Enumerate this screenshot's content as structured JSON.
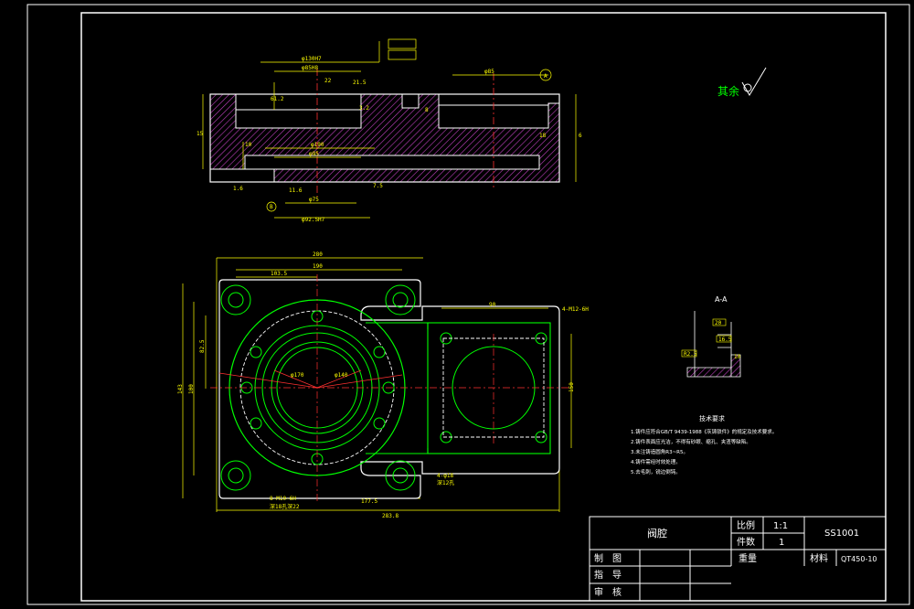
{
  "title_block": {
    "part_name": "阀腔",
    "scale_label": "比例",
    "scale_value": "1:1",
    "qty_label": "件数",
    "qty_value": "1",
    "drawing_no": "SS1001",
    "weight_label": "重量",
    "material_label": "材料",
    "material_value": "QT450-10",
    "drawn_label": "制　图",
    "guide_label": "指　导",
    "review_label": "审　核"
  },
  "roughness_note": "其余",
  "section_label": "A-A",
  "tech_requirements": {
    "title": "技术要求",
    "items": [
      "1.铸件应符合GB/T 9439-1988《灰铸铁件》的规定及技术要求。",
      "2.铸件表面应光洁，不得有砂眼、缩孔、夹渣等缺陷。",
      "3.未注铸造圆角R3~R5。",
      "4.铸件需经时效处理。",
      "5.去毛刺，锐边倒钝。"
    ]
  },
  "dims": {
    "top_total": "280",
    "top_inner": "190",
    "top_left": "103.5",
    "right_w": "90",
    "hole_note_r": "4-M12-6H",
    "left_h1": "143",
    "left_h2": "100",
    "left_h3": "82.5",
    "right_h": "150",
    "bottom_1": "177.5",
    "bottom_2": "283.8",
    "note_bl1": "8-M10-6H",
    "note_bl2": "深18孔深22",
    "note_br1": "4-φ18",
    "note_br2": "深12孔",
    "dia1": "φ170",
    "dia2": "φ140",
    "sec_d1": "φ130H7",
    "sec_d2": "φ85H8",
    "sec_d3": "φ190",
    "sec_d4": "φ95",
    "sec_d5": "φ75",
    "sec_d6": "φ85",
    "sec_d7": "φ92.5H7",
    "sec_h1": "61.2",
    "sec_h2": "10",
    "sec_h3": "22",
    "sec_h4": "18",
    "sec_h5": "21.5",
    "sec_h6": "15",
    "sec_h7": "11.6",
    "sec_h8": "7.5",
    "sec_h9": "8",
    "sec_h10": "6",
    "sec_h11": "3.2",
    "sec_h12": "1.6",
    "datum_a": "A",
    "datum_b": "B",
    "aa_d1": "20",
    "aa_d2": "16.5",
    "aa_d3": "10",
    "aa_d4": "R2.5"
  }
}
